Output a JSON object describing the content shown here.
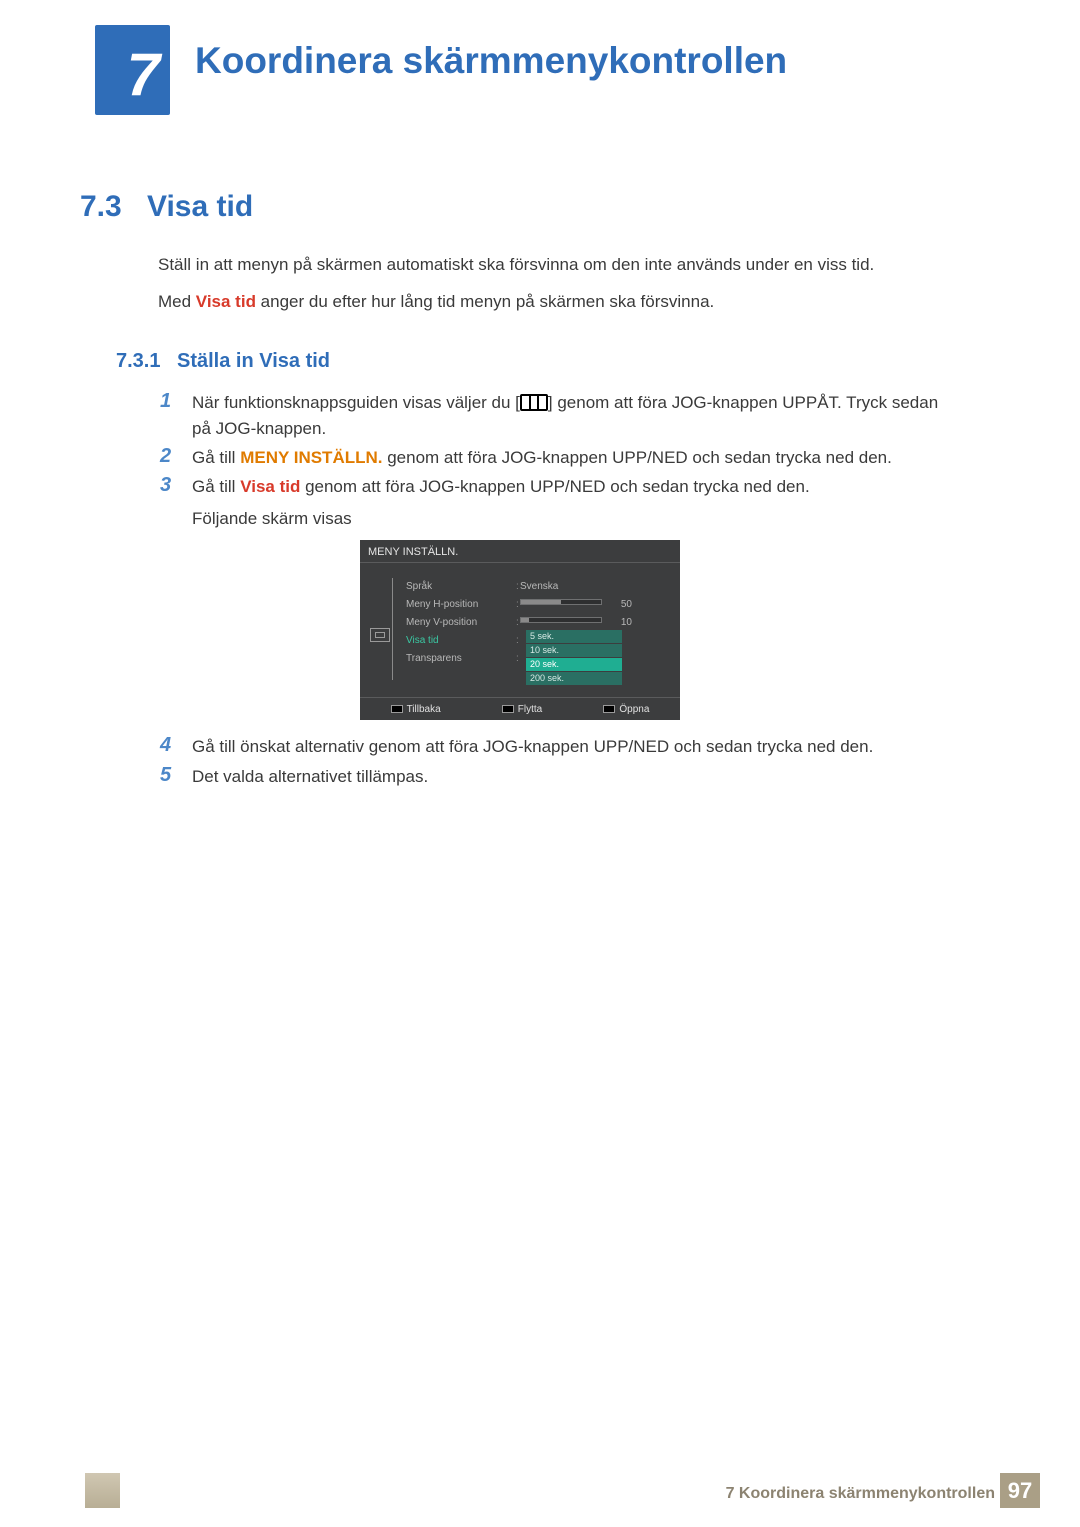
{
  "header": {
    "chapter_number": "7",
    "chapter_title": "Koordinera skärmmenykontrollen"
  },
  "section": {
    "number": "7.3",
    "title": "Visa tid"
  },
  "paragraphs": {
    "p1": "Ställ in att menyn på skärmen automatiskt ska försvinna om den inte används under en viss tid.",
    "p2a": "Med ",
    "p2b": "Visa tid",
    "p2c": " anger du efter hur lång tid menyn på skärmen ska försvinna."
  },
  "subsection": {
    "number": "7.3.1",
    "title": "Ställa in Visa tid"
  },
  "steps": {
    "n1": "1",
    "n2": "2",
    "n3": "3",
    "n4": "4",
    "n5": "5",
    "s1a": "När funktionsknappsguiden visas väljer du [",
    "s1b": "] genom att föra JOG-knappen UPPÅT. Tryck sedan på JOG-knappen.",
    "s2a": "Gå till ",
    "s2b": "MENY INSTÄLLN.",
    "s2c": " genom att föra JOG-knappen UPP/NED och sedan trycka ned den.",
    "s3a": "Gå till ",
    "s3b": "Visa tid",
    "s3c": " genom att föra JOG-knappen UPP/NED och sedan trycka ned den.",
    "s3d": "Följande skärm visas",
    "s4": "Gå till önskat alternativ genom att föra JOG-knappen UPP/NED och sedan trycka ned den.",
    "s5": "Det valda alternativet tillämpas."
  },
  "osd": {
    "title": "MENY INSTÄLLN.",
    "labels": {
      "lang": "Språk",
      "hpos": "Meny H-position",
      "vpos": "Meny V-position",
      "visa": "Visa tid",
      "trans": "Transparens"
    },
    "values": {
      "lang": "Svenska",
      "hpos": "50",
      "vpos": "10"
    },
    "options": {
      "o1": "5 sek.",
      "o2": "10 sek.",
      "o3": "20 sek.",
      "o4": "200 sek."
    },
    "footer": {
      "back": "Tillbaka",
      "move": "Flytta",
      "open": "Öppna"
    }
  },
  "footer": {
    "text": "7 Koordinera skärmmenykontrollen",
    "page": "97"
  }
}
